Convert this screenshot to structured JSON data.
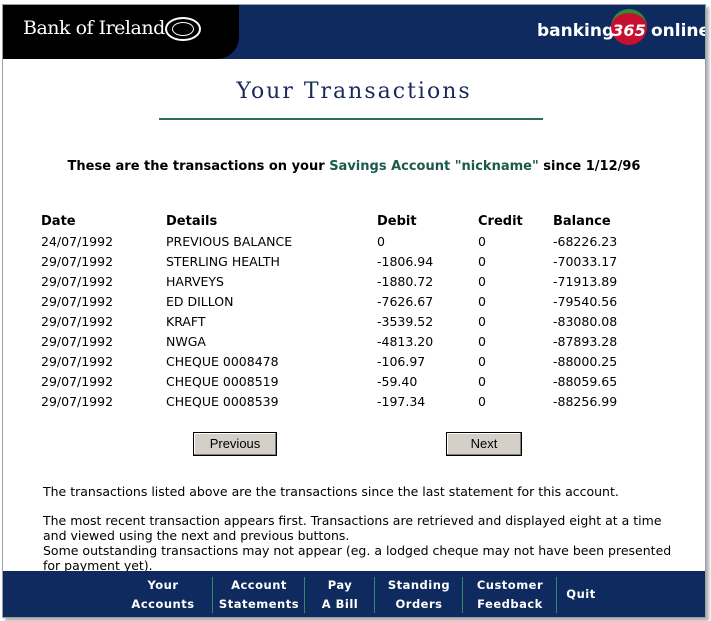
{
  "header": {
    "bank_name": "Bank of Ireland",
    "brand_left": "banking",
    "brand_badge": "365",
    "brand_right": "online"
  },
  "page": {
    "title": "Your Transactions",
    "summary_prefix": "These are the transactions on your ",
    "account_label": "Savings Account \"nickname\"",
    "summary_suffix": " since 1/12/96"
  },
  "table": {
    "headers": [
      "Date",
      "Details",
      "Debit",
      "Credit",
      "Balance"
    ],
    "rows": [
      [
        "24/07/1992",
        "PREVIOUS BALANCE",
        "0",
        "0",
        "-68226.23"
      ],
      [
        "29/07/1992",
        "STERLING HEALTH",
        "-1806.94",
        "0",
        "-70033.17"
      ],
      [
        "29/07/1992",
        "HARVEYS",
        "-1880.72",
        "0",
        "-71913.89"
      ],
      [
        "29/07/1992",
        "ED DILLON",
        "-7626.67",
        "0",
        "-79540.56"
      ],
      [
        "29/07/1992",
        "KRAFT",
        "-3539.52",
        "0",
        "-83080.08"
      ],
      [
        "29/07/1992",
        "NWGA",
        "-4813.20",
        "0",
        "-87893.28"
      ],
      [
        "29/07/1992",
        "CHEQUE 0008478",
        "-106.97",
        "0",
        "-88000.25"
      ],
      [
        "29/07/1992",
        "CHEQUE 0008519",
        "-59.40",
        "0",
        "-88059.65"
      ],
      [
        "29/07/1992",
        "CHEQUE 0008539",
        "-197.34",
        "0",
        "-88256.99"
      ]
    ]
  },
  "buttons": {
    "previous": "Previous",
    "next": "Next"
  },
  "notes": {
    "line1": "The transactions listed above are the transactions since the last statement for this account.",
    "line2": "The most recent transaction appears first. Transactions are retrieved and displayed eight at a time and viewed using the next and previous buttons.",
    "line3": "Some outstanding transactions may not appear (eg. a lodged cheque may not have been presented for payment yet)."
  },
  "footer": {
    "items": [
      {
        "line1": "Your",
        "line2": "Accounts"
      },
      {
        "line1": "Account",
        "line2": "Statements"
      },
      {
        "line1": "Pay",
        "line2": "A Bill"
      },
      {
        "line1": "Standing",
        "line2": "Orders"
      },
      {
        "line1": "Customer",
        "line2": "Feedback"
      },
      {
        "line1": "Quit",
        "line2": ""
      }
    ]
  },
  "colors": {
    "navy": "#0e2a5f",
    "accent_green": "#2f6b56",
    "account_text": "#1b5a4a"
  }
}
